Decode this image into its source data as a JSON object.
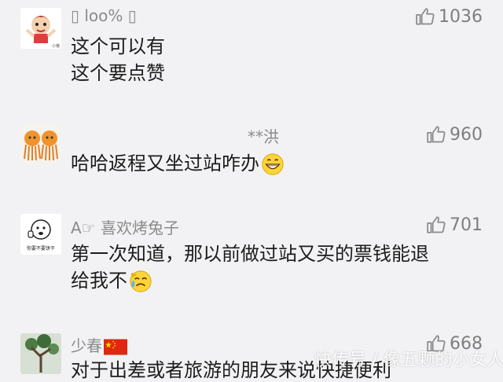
{
  "comments": [
    {
      "username": "▯ loo% ▯",
      "likes": "1036",
      "lines": [
        "这个可以有",
        "这个要点赞"
      ],
      "avatar_caption": "小猪"
    },
    {
      "username": "**洪",
      "likes": "960",
      "lines": [
        "哈哈返程又坐过站咋办"
      ],
      "emoji": "grinning-face"
    },
    {
      "username": "A☞ 喜欢烤兔子",
      "likes": "701",
      "lines": [
        "第一次知道，那以前做过站又买的票钱能退",
        "给我不"
      ],
      "emoji": "crying-face",
      "avatar_caption": "你要不要饼干"
    },
    {
      "username": "少春",
      "likes": "668",
      "lines": [
        "对于出差或者旅游的朋友来说快捷便利"
      ],
      "flag": "china-flag"
    }
  ],
  "watermark": "快传号 / 像五颗的小女人"
}
